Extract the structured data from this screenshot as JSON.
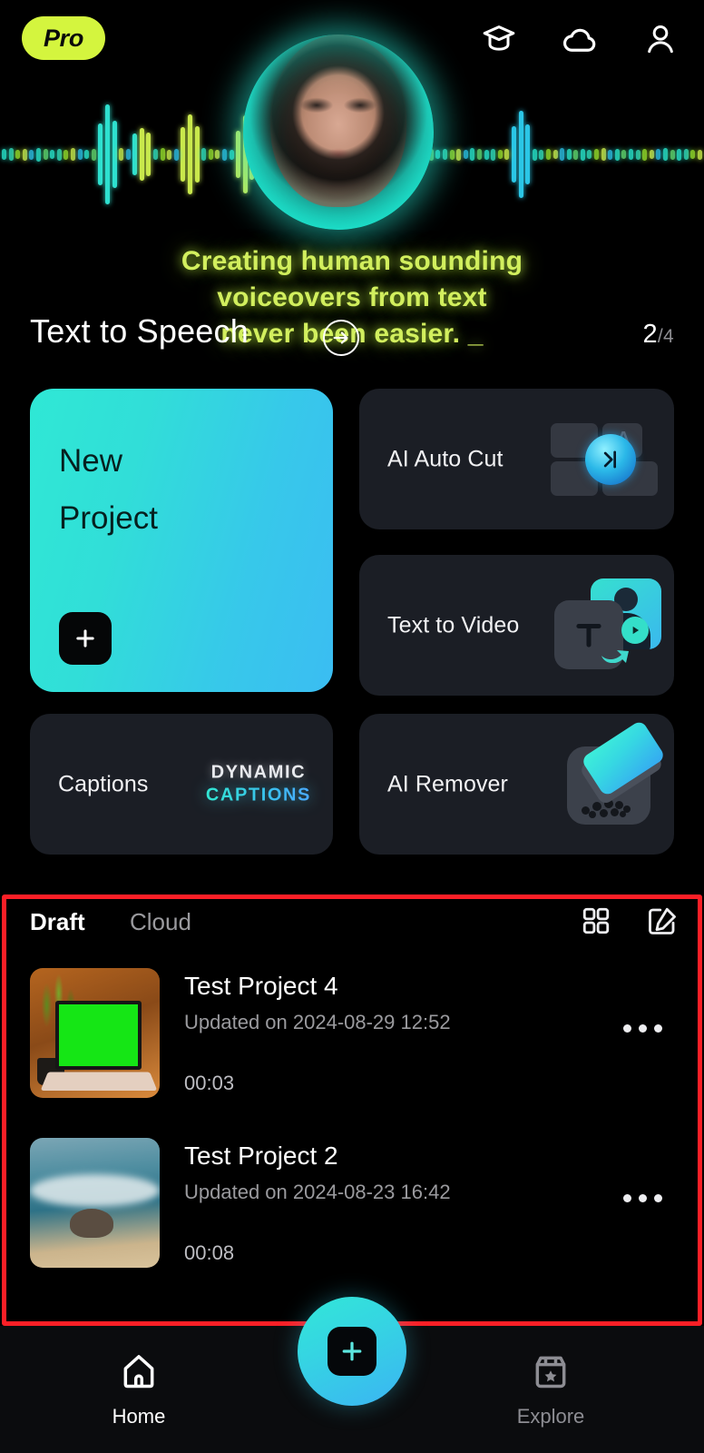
{
  "header": {
    "pro_badge": "Pro",
    "icons": [
      {
        "name": "graduation-cap-icon",
        "label": "Learn"
      },
      {
        "name": "cloud-icon",
        "label": "Cloud"
      },
      {
        "name": "profile-icon",
        "label": "Profile"
      }
    ]
  },
  "hero": {
    "caption_line1": "Creating human sounding",
    "caption_line2": "voiceovers from text",
    "caption_line3": "never been easier. _",
    "title": "Text to Speech",
    "page_current": "2",
    "page_total": "/4",
    "arrow_icon": "arrow-right-circle-icon",
    "accent_green": "#d2ef5e",
    "accent_teal": "#2fe8d5"
  },
  "features": {
    "new_project": {
      "line1": "New",
      "line2": "Project",
      "plus_icon": "plus-icon",
      "gradient_from": "#2fe8d5",
      "gradient_to": "#3bbdf2"
    },
    "cards": [
      {
        "label": "AI Auto Cut",
        "icon": "ai-auto-cut-icon"
      },
      {
        "label": "Text to Video",
        "icon": "text-to-video-icon"
      },
      {
        "label": "Captions",
        "icon": "dynamic-captions-icon",
        "art_line1": "DYNAMIC",
        "art_line2": "CAPTIONS"
      },
      {
        "label": "AI Remover",
        "icon": "ai-remover-icon"
      }
    ]
  },
  "drafts": {
    "tabs": [
      {
        "label": "Draft",
        "active": true
      },
      {
        "label": "Cloud",
        "active": false
      }
    ],
    "grid_icon": "grid-view-icon",
    "edit_icon": "edit-square-icon",
    "items": [
      {
        "title": "Test Project 4",
        "updated": "Updated on 2024-08-29 12:52",
        "duration": "00:03",
        "more_icon": "more-options-icon"
      },
      {
        "title": "Test Project 2",
        "updated": "Updated on 2024-08-23 16:42",
        "duration": "00:08",
        "more_icon": "more-options-icon"
      }
    ],
    "highlight_color": "#fd1f26"
  },
  "navbar": {
    "home": {
      "label": "Home",
      "icon": "home-icon",
      "active": true
    },
    "create": {
      "icon": "plus-icon",
      "label": "Create"
    },
    "explore": {
      "label": "Explore",
      "icon": "explore-bag-icon",
      "active": false
    }
  }
}
